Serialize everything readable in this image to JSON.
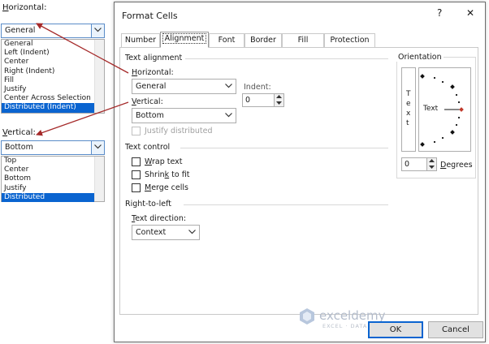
{
  "callouts": {
    "horizontal": {
      "label_acc": "H",
      "label_rest": "orizontal:",
      "value": "General",
      "options": [
        "General",
        "Left (Indent)",
        "Center",
        "Right (Indent)",
        "Fill",
        "Justify",
        "Center Across Selection",
        "Distributed (Indent)"
      ],
      "selected_index": 7
    },
    "vertical": {
      "label_acc": "V",
      "label_rest": "ertical:",
      "value": "Bottom",
      "options": [
        "Top",
        "Center",
        "Bottom",
        "Justify",
        "Distributed"
      ],
      "selected_index": 4
    }
  },
  "dialog": {
    "title": "Format Cells",
    "help": "?",
    "close": "✕",
    "tabs": [
      "Number",
      "Alignment",
      "Font",
      "Border",
      "Fill",
      "Protection"
    ],
    "active_tab_index": 1,
    "text_alignment": {
      "section": "Text alignment",
      "horizontal_acc": "H",
      "horizontal_rest": "orizontal:",
      "horizontal_value": "General",
      "indent_label": "Indent:",
      "indent_value": "0",
      "vertical_acc": "V",
      "vertical_rest": "ertical:",
      "vertical_value": "Bottom",
      "justify_distributed": "Justify distributed",
      "justify_distributed_checked": false
    },
    "text_control": {
      "section": "Text control",
      "wrap_acc": "W",
      "wrap_rest": "rap text",
      "shrink_pre": "Shrin",
      "shrink_acc": "k",
      "shrink_post": " to fit",
      "merge_acc": "M",
      "merge_rest": "erge cells",
      "wrap_checked": false,
      "shrink_checked": false,
      "merge_checked": false
    },
    "rtl": {
      "section": "Right-to-left",
      "dir_acc": "T",
      "dir_rest": "ext direction:",
      "dir_value": "Context"
    },
    "orientation": {
      "section": "Orientation",
      "vertical_letters": [
        "T",
        "e",
        "x",
        "t"
      ],
      "dial_text": "Text",
      "degrees_value": "0",
      "degrees_acc": "D",
      "degrees_rest": "egrees"
    },
    "buttons": {
      "ok": "OK",
      "cancel": "Cancel"
    }
  },
  "watermark": {
    "brand": "exceldemy",
    "tagline": "EXCEL · DATA · BI"
  },
  "colors": {
    "selection": "#0a64d0",
    "arrow": "#a52a2a",
    "combo_border": "#5a8cc8",
    "dial_marker": "#c0392b"
  }
}
